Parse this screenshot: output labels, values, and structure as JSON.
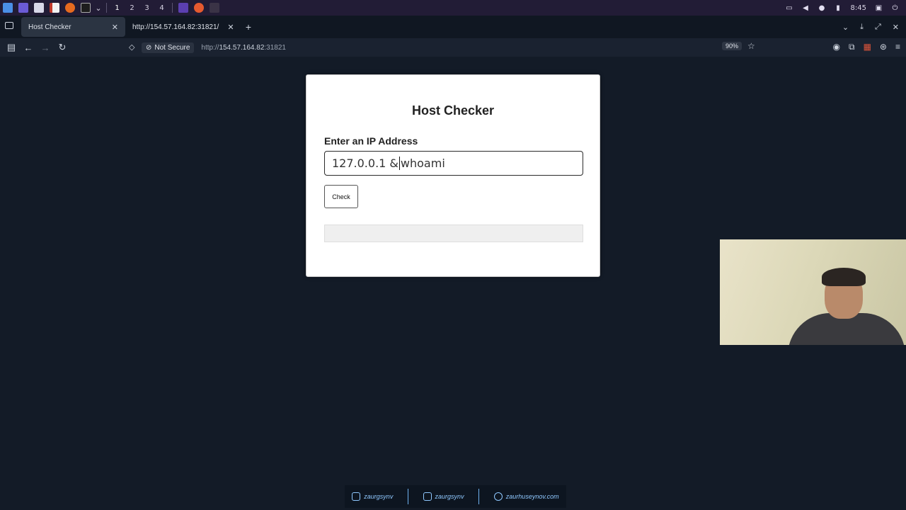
{
  "os_bar": {
    "workspaces": [
      "1",
      "2",
      "3",
      "4"
    ],
    "clock": "8:45"
  },
  "browser": {
    "tabs": [
      {
        "label": "Host Checker",
        "active": true
      },
      {
        "label": "http://154.57.164.82:31821/",
        "active": false
      }
    ],
    "security_label": "Not Secure",
    "url_prefix": "http://",
    "url_host": "154.57.164.82",
    "url_port": ":31821",
    "zoom": "90%"
  },
  "page": {
    "title": "Host Checker",
    "input_label": "Enter an IP Address",
    "input_value_before_caret": "127.0.0.1 &",
    "input_value_after_caret": "whoami",
    "check_button": "Check",
    "result_text": ""
  },
  "footer": {
    "instagram": "zaurgsynv",
    "youtube": "zaurgsynv",
    "website": "zaurhuseynov.com"
  }
}
